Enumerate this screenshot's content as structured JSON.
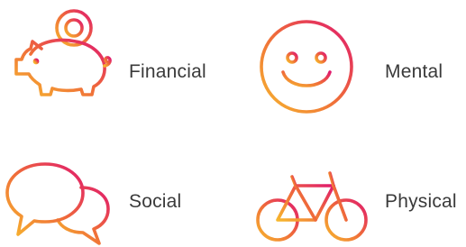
{
  "items": [
    {
      "label": "Financial",
      "icon": "piggy-bank-icon"
    },
    {
      "label": "Mental",
      "icon": "smiley-face-icon"
    },
    {
      "label": "Social",
      "icon": "speech-bubbles-icon"
    },
    {
      "label": "Physical",
      "icon": "bicycle-icon"
    }
  ],
  "colors": {
    "gradient_start": "#f7b72e",
    "gradient_mid": "#ef6a3a",
    "gradient_end": "#e0196e",
    "label_text": "#3a3a3a"
  }
}
